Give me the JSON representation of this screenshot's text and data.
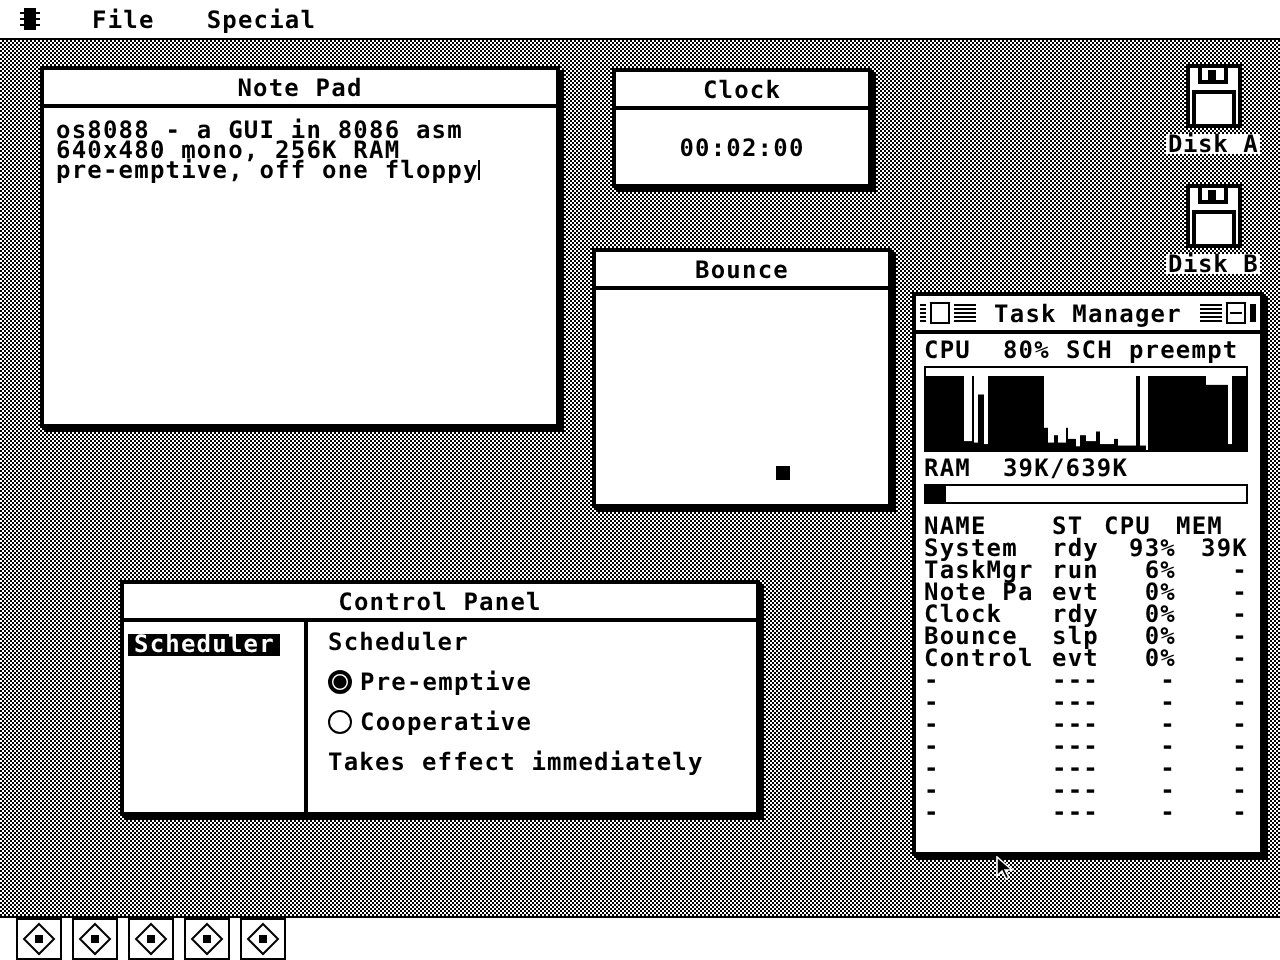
{
  "menu_bar": {
    "items": [
      "File",
      "Special"
    ]
  },
  "note_pad": {
    "title": "Note Pad",
    "lines": [
      "os8088 - a GUI in 8086 asm",
      "640x480 mono, 256K RAM",
      "pre-emptive, off one floppy"
    ],
    "caret_visible": true
  },
  "clock": {
    "title": "Clock",
    "time": "00:02:00"
  },
  "bounce": {
    "title": "Bounce"
  },
  "desktop_icons": [
    {
      "label": "Disk A"
    },
    {
      "label": "Disk B"
    }
  ],
  "task_manager": {
    "title": "Task Manager",
    "cpu_label": "CPU",
    "cpu_value": "80%",
    "sch_label": "SCH",
    "sch_value": "preempt",
    "ram_label": "RAM",
    "ram_value": "39K/639K",
    "ram": {
      "level": 0.06
    },
    "columns": [
      "NAME",
      "ST",
      "CPU",
      "MEM"
    ],
    "rows": [
      [
        "System",
        "rdy",
        "93%",
        "39K"
      ],
      [
        "TaskMgr",
        "run",
        "6%",
        "-"
      ],
      [
        "Note Pa",
        "evt",
        "0%",
        "-"
      ],
      [
        "Clock",
        "rdy",
        "0%",
        "-"
      ],
      [
        "Bounce",
        "slp",
        "0%",
        "-"
      ],
      [
        "Control",
        "evt",
        "0%",
        "-"
      ],
      [
        "-",
        "---",
        "-",
        "-"
      ],
      [
        "-",
        "---",
        "-",
        "-"
      ],
      [
        "-",
        "---",
        "-",
        "-"
      ],
      [
        "-",
        "---",
        "-",
        "-"
      ],
      [
        "-",
        "---",
        "-",
        "-"
      ],
      [
        "-",
        "---",
        "-",
        "-"
      ],
      [
        "-",
        "---",
        "-",
        "-"
      ]
    ]
  },
  "control_panel": {
    "title": "Control Panel",
    "sidebar": [
      {
        "label": "Scheduler",
        "selected": true
      }
    ],
    "heading": "Scheduler",
    "options": [
      {
        "label": "Pre-emptive",
        "selected": true
      },
      {
        "label": "Cooperative",
        "selected": false
      }
    ],
    "note": "Takes effect immediately"
  },
  "taskbar": {
    "buttons": [
      {
        "kind": "app"
      },
      {
        "kind": "app"
      },
      {
        "kind": "app"
      },
      {
        "kind": "app"
      },
      {
        "kind": "app"
      }
    ]
  }
}
